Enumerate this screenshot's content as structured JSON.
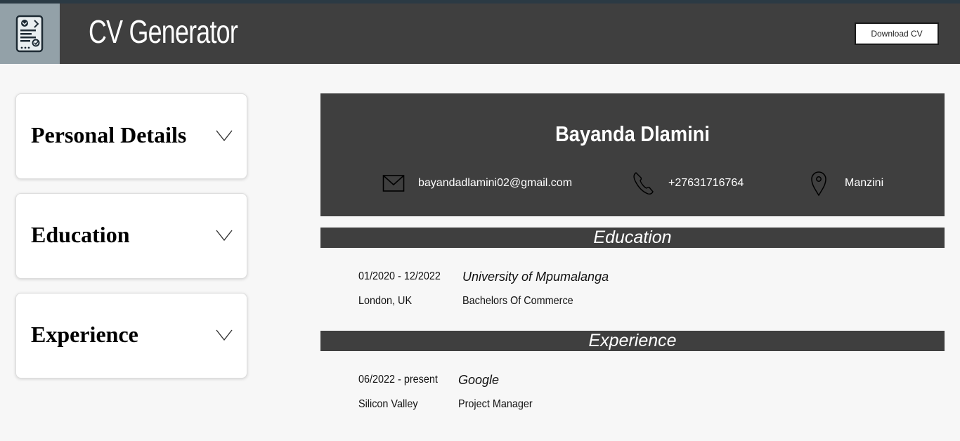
{
  "header": {
    "title": "CV Generator",
    "download_label": "Download CV",
    "logo_icon": "cv-document-icon"
  },
  "sidebar": {
    "sections": [
      {
        "label": "Personal Details",
        "icon": "chevron-down-icon"
      },
      {
        "label": "Education",
        "icon": "chevron-down-icon"
      },
      {
        "label": "Experience",
        "icon": "chevron-down-icon"
      }
    ]
  },
  "cv": {
    "name": "Bayanda Dlamini",
    "contacts": {
      "email": "bayandadlamini02@gmail.com",
      "phone": "+27631716764",
      "location": "Manzini"
    },
    "education": {
      "title": "Education",
      "entries": [
        {
          "dates": "01/2020 - 12/2022",
          "location": "London, UK",
          "school": "University of Mpumalanga",
          "degree": "Bachelors Of Commerce"
        }
      ]
    },
    "experience": {
      "title": "Experience",
      "entries": [
        {
          "dates": "06/2022 - present",
          "location": "Silicon Valley",
          "company": "Google",
          "position": "Project Manager"
        }
      ]
    }
  },
  "colors": {
    "dark": "#3f3f3f",
    "background": "#f7f7f7",
    "logo_bg": "#93a1a8"
  }
}
